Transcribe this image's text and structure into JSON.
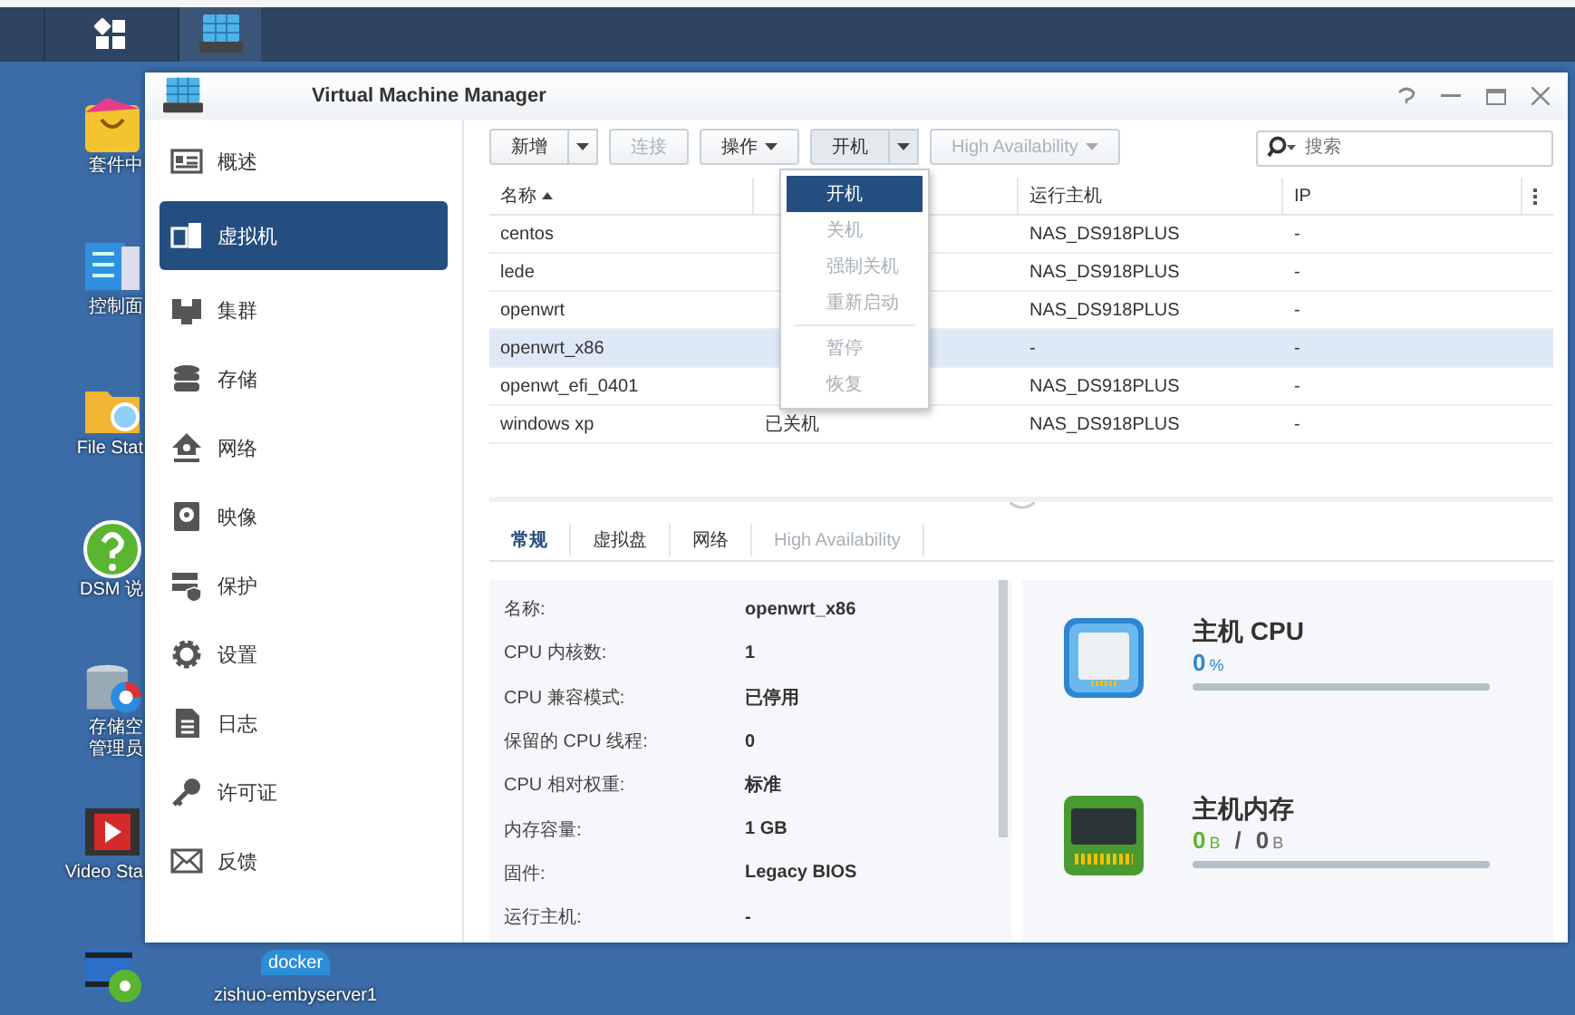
{
  "taskbar": {
    "apps": [
      {
        "kind": "main-menu",
        "selected": false
      },
      {
        "kind": "vmm",
        "selected": true
      }
    ]
  },
  "desktop": {
    "icons": [
      {
        "kind": "package",
        "label": "套件中"
      },
      {
        "kind": "control",
        "label": "控制面"
      },
      {
        "kind": "folder",
        "label": "File Stat"
      },
      {
        "kind": "help",
        "label": "DSM 说"
      },
      {
        "kind": "storage",
        "label_lines": [
          "存储空",
          "管理员"
        ]
      },
      {
        "kind": "video",
        "label": "Video Sta"
      },
      {
        "kind": "media"
      }
    ],
    "bottom_icons": [
      {
        "kind": "docker",
        "logo_text": "docker",
        "label": "zishuo-embyserver1"
      }
    ]
  },
  "window": {
    "title": "Virtual Machine Manager"
  },
  "sidebar": {
    "items": [
      {
        "kind": "overview",
        "label": "概述",
        "selected": false
      },
      {
        "kind": "vm",
        "label": "虚拟机",
        "selected": true
      },
      {
        "kind": "cluster",
        "label": "集群",
        "selected": false
      },
      {
        "kind": "storage",
        "label": "存储",
        "selected": false
      },
      {
        "kind": "network",
        "label": "网络",
        "selected": false
      },
      {
        "kind": "image",
        "label": "映像",
        "selected": false
      },
      {
        "kind": "protect",
        "label": "保护",
        "selected": false
      },
      {
        "kind": "settings",
        "label": "设置",
        "selected": false
      },
      {
        "kind": "log",
        "label": "日志",
        "selected": false
      },
      {
        "kind": "license",
        "label": "许可证",
        "selected": false
      },
      {
        "kind": "feedback",
        "label": "反馈",
        "selected": false
      }
    ]
  },
  "toolbar": {
    "buttons": [
      {
        "kind": "split",
        "label": "新增",
        "disabled": false,
        "pressed": false
      },
      {
        "kind": "plain",
        "label": "连接",
        "disabled": true,
        "pressed": false
      },
      {
        "kind": "menu",
        "label": "操作",
        "disabled": false,
        "pressed": false
      },
      {
        "kind": "split",
        "label": "开机",
        "disabled": false,
        "pressed": true
      },
      {
        "kind": "menu",
        "label": "High Availability",
        "disabled": true,
        "pressed": false
      }
    ],
    "search": {
      "placeholder": "搜索"
    }
  },
  "table": {
    "columns": [
      {
        "kind": "name",
        "label": "名称",
        "sorted": true
      },
      {
        "kind": "status"
      },
      {
        "kind": "host",
        "label": "运行主机",
        "sorted": false
      },
      {
        "kind": "ip",
        "label": "IP",
        "sorted": false
      }
    ],
    "rows": [
      {
        "name": "centos",
        "host": "NAS_DS918PLUS",
        "ip": "-",
        "selected": false
      },
      {
        "name": "lede",
        "host": "NAS_DS918PLUS",
        "ip": "-",
        "selected": false
      },
      {
        "name": "openwrt",
        "host": "NAS_DS918PLUS",
        "ip": "-",
        "selected": false
      },
      {
        "name": "openwrt_x86",
        "host": "-",
        "ip": "-",
        "selected": true
      },
      {
        "name": "openwt_efi_0401",
        "host": "NAS_DS918PLUS",
        "ip": "-",
        "selected": false
      },
      {
        "name": "windows xp",
        "status": "已关机",
        "host": "NAS_DS918PLUS",
        "ip": "-",
        "selected": false
      }
    ]
  },
  "dropdown_menu": {
    "items": [
      {
        "label": "开机",
        "selected": true,
        "disabled": false,
        "separator_before": false
      },
      {
        "label": "关机",
        "selected": false,
        "disabled": true,
        "separator_before": false
      },
      {
        "label": "强制关机",
        "selected": false,
        "disabled": true,
        "separator_before": false
      },
      {
        "label": "重新启动",
        "selected": false,
        "disabled": true,
        "separator_before": false
      },
      {
        "label": "暂停",
        "selected": false,
        "disabled": true,
        "separator_before": true
      },
      {
        "label": "恢复",
        "selected": false,
        "disabled": true,
        "separator_before": false
      }
    ]
  },
  "details": {
    "tabs": [
      {
        "label": "常规",
        "selected": true,
        "disabled": false
      },
      {
        "label": "虚拟盘",
        "selected": false,
        "disabled": false
      },
      {
        "label": "网络",
        "selected": false,
        "disabled": false
      },
      {
        "label": "High Availability",
        "selected": false,
        "disabled": true
      }
    ],
    "properties": [
      {
        "label": "名称:",
        "value": "openwrt_x86"
      },
      {
        "label": "CPU 内核数:",
        "value": "1"
      },
      {
        "label": "CPU 兼容模式:",
        "value": "已停用"
      },
      {
        "label": "保留的 CPU 线程:",
        "value": "0"
      },
      {
        "label": "CPU 相对权重:",
        "value": "标准"
      },
      {
        "label": "内存容量:",
        "value": "1 GB"
      },
      {
        "label": "固件:",
        "value": "Legacy BIOS"
      },
      {
        "label": "运行主机:",
        "value": "-"
      }
    ],
    "monitors": [
      {
        "kind": "cpu",
        "title": "主机 CPU",
        "value": "0",
        "unit": "%",
        "level": 0
      },
      {
        "kind": "memory",
        "title": "主机内存",
        "value": "0",
        "unit": "B",
        "separator": "/",
        "total": "0",
        "total_unit": "B",
        "level": 0
      }
    ]
  }
}
